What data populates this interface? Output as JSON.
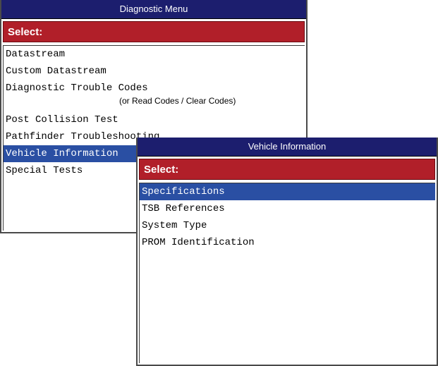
{
  "diagnostic_menu": {
    "title": "Diagnostic Menu",
    "select_label": "Select:",
    "items": [
      {
        "label": "Datastream"
      },
      {
        "label": "Custom Datastream"
      },
      {
        "label": "Diagnostic Trouble Codes",
        "sublabel": "(or Read Codes / Clear Codes)"
      },
      {
        "label": "Post Collision Test"
      },
      {
        "label": "Pathfinder Troubleshooting"
      },
      {
        "label": "Vehicle Information",
        "selected": true
      },
      {
        "label": "Special Tests"
      }
    ]
  },
  "vehicle_information": {
    "title": "Vehicle Information",
    "select_label": "Select:",
    "items": [
      {
        "label": "Specifications",
        "selected": true
      },
      {
        "label": "TSB References"
      },
      {
        "label": "System Type"
      },
      {
        "label": "PROM Identification"
      }
    ]
  },
  "colors": {
    "titlebar": "#1c1e6e",
    "select_bar": "#b11f29",
    "highlight": "#2a4fa3"
  }
}
